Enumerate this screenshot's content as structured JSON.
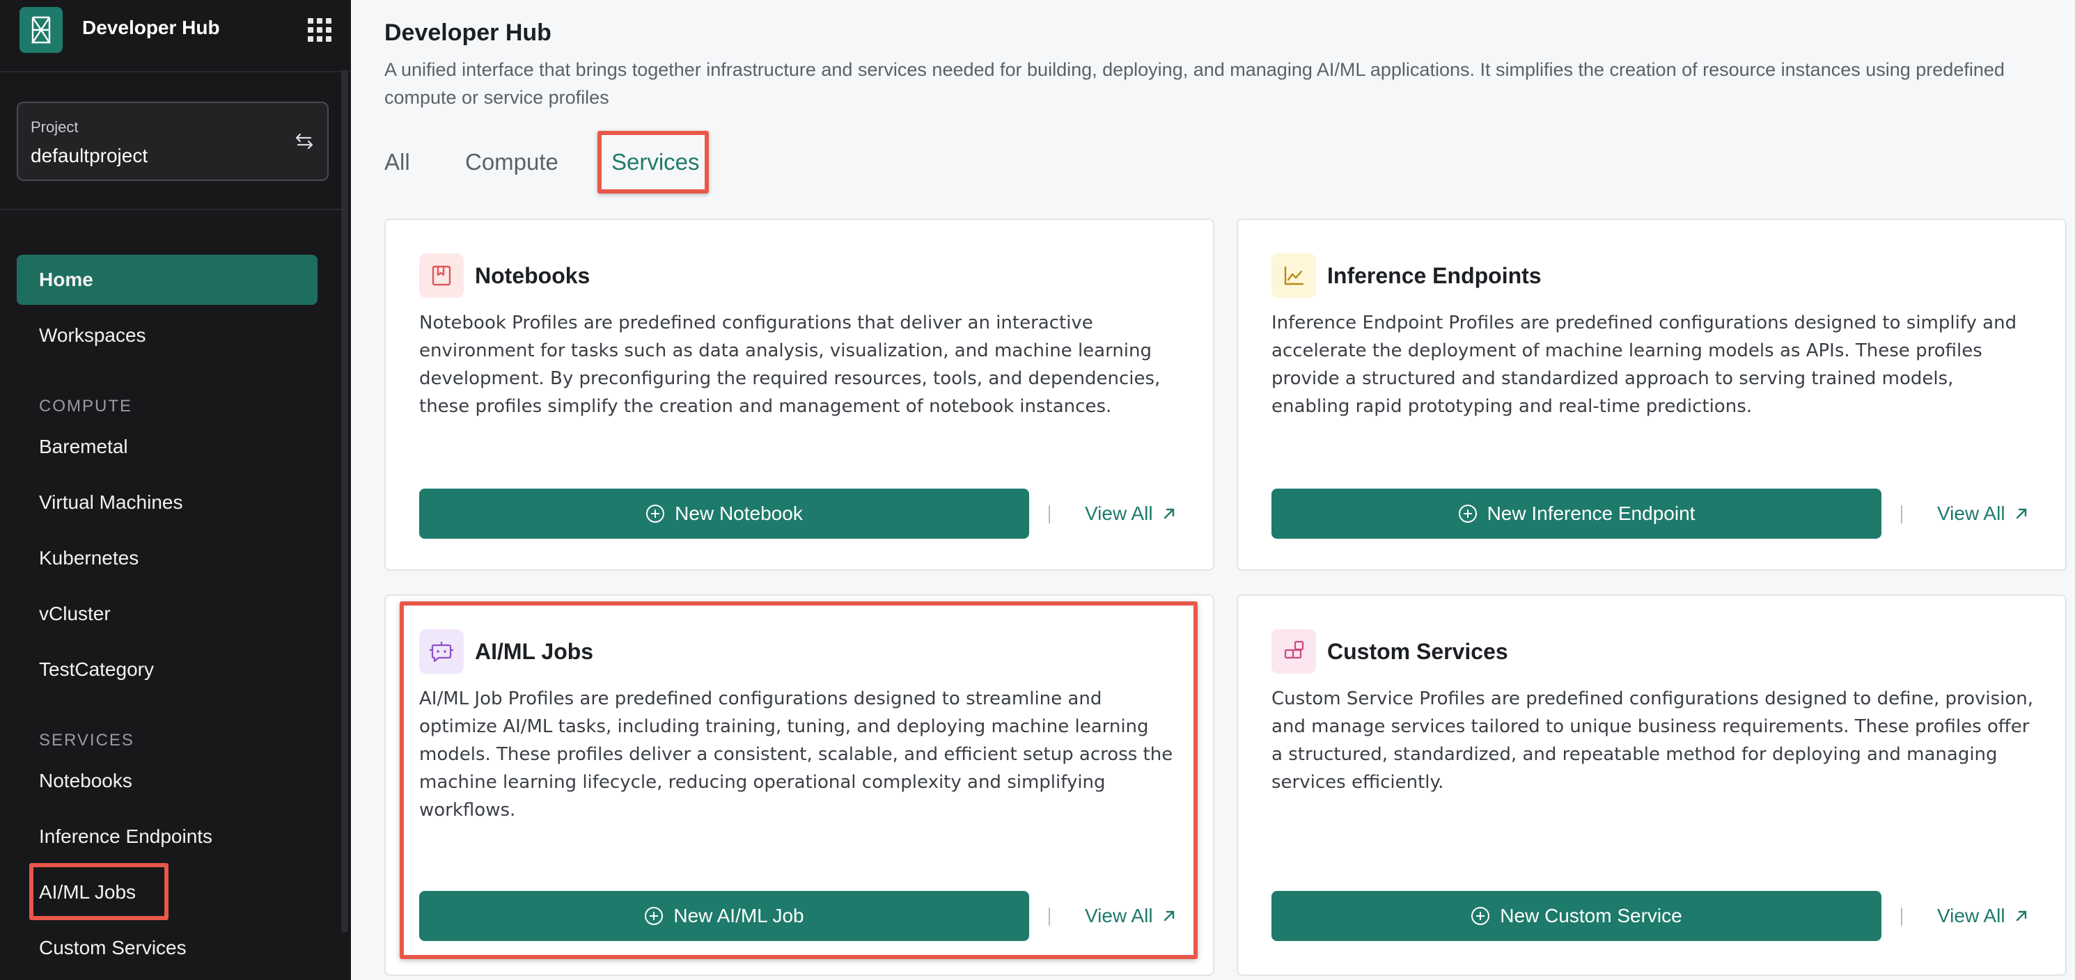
{
  "app": {
    "title": "Developer Hub"
  },
  "project": {
    "label": "Project",
    "value": "defaultproject"
  },
  "nav": {
    "home": "Home",
    "workspaces": "Workspaces",
    "compute_header": "COMPUTE",
    "compute_items": [
      "Baremetal",
      "Virtual Machines",
      "Kubernetes",
      "vCluster",
      "TestCategory"
    ],
    "services_header": "SERVICES",
    "service_items": [
      "Notebooks",
      "Inference Endpoints",
      "AI/ML Jobs",
      "Custom Services"
    ],
    "active": "Home"
  },
  "header": {
    "title": "Developer Hub",
    "description": "A unified interface that brings together infrastructure and services needed for building, deploying, and managing AI/ML applications. It simplifies the creation of resource instances using predefined compute or service profiles"
  },
  "tabs": [
    {
      "label": "All"
    },
    {
      "label": "Compute"
    },
    {
      "label": "Services",
      "active": true
    }
  ],
  "cards": [
    {
      "title": "Notebooks",
      "icon": "bookmark-icon",
      "icon_color": "#e0575b",
      "icon_bg": "#fde8e8",
      "description": "Notebook Profiles are predefined configurations that deliver an interactive environment for tasks such as data analysis, visualization, and machine learning development. By preconfiguring the required resources, tools, and dependencies, these profiles simplify the creation and management of notebook instances.",
      "button": "New Notebook",
      "link": "View All"
    },
    {
      "title": "Inference Endpoints",
      "icon": "line-chart-icon",
      "icon_color": "#b8891a",
      "icon_bg": "#fdf6d8",
      "description": "Inference Endpoint Profiles are predefined configurations designed to simplify and accelerate the deployment of machine learning models as APIs. These profiles provide a structured and standardized approach to serving trained models, enabling rapid prototyping and real-time predictions.",
      "button": "New Inference Endpoint",
      "link": "View All"
    },
    {
      "title": "AI/ML Jobs",
      "icon": "bot-icon",
      "icon_color": "#8b4fc9",
      "icon_bg": "#f1e7fb",
      "description": "AI/ML Job Profiles are predefined configurations designed to streamline and optimize AI/ML tasks, including training, tuning, and deploying machine learning models. These profiles deliver a consistent, scalable, and efficient setup across the machine learning lifecycle, reducing operational complexity and simplifying workflows.",
      "button": "New AI/ML Job",
      "link": "View All"
    },
    {
      "title": "Custom Services",
      "icon": "blocks-icon",
      "icon_color": "#d0477a",
      "icon_bg": "#fce6ef",
      "description": "Custom Service Profiles are predefined configurations designed to define, provision, and manage services tailored to unique business requirements. These profiles offer a structured, standardized, and repeatable method for deploying and managing services efficiently.",
      "button": "New Custom Service",
      "link": "View All"
    }
  ],
  "colors": {
    "accent": "#1e7a6b",
    "sidebar_bg": "#18181b",
    "highlight": "#e8584a"
  }
}
